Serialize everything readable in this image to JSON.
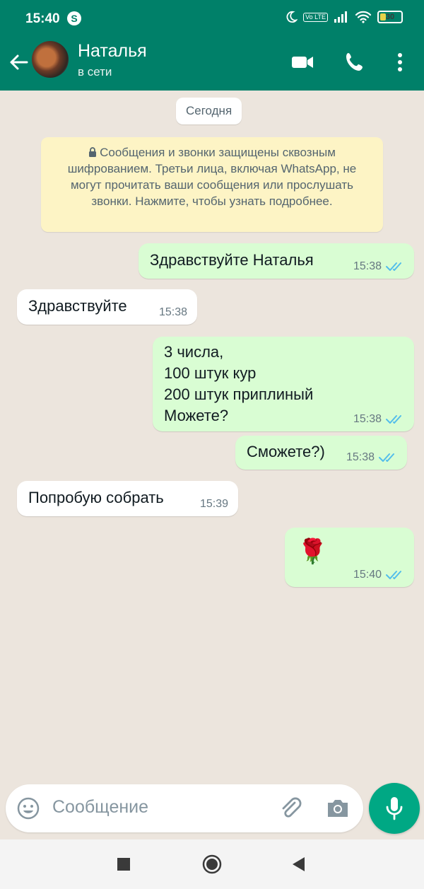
{
  "status_bar": {
    "time": "15:40",
    "app_badge": "S",
    "volte": "Vo LTE",
    "battery": "30",
    "battery_level": 0.3
  },
  "header": {
    "contact_name": "Наталья",
    "contact_status": "в сети"
  },
  "chat": {
    "date_chip": "Сегодня",
    "encryption_notice": "Сообщения и звонки защищены сквозным шифрованием. Третьи лица, включая WhatsApp, не могут прочитать ваши сообщения или прослушать звонки. Нажмите, чтобы узнать подробнее.",
    "messages": [
      {
        "direction": "out",
        "text": "Здравствуйте Наталья",
        "time": "15:38",
        "status": "read"
      },
      {
        "direction": "in",
        "text": "Здравствуйте",
        "time": "15:38"
      },
      {
        "direction": "out",
        "text": "3 числа,\n100 штук кур\n200 штук приплиный\nМожете?",
        "time": "15:38",
        "status": "read"
      },
      {
        "direction": "out",
        "text": "Сможете?)",
        "time": "15:38",
        "status": "read"
      },
      {
        "direction": "in",
        "text": "Попробую собрать",
        "time": "15:39"
      },
      {
        "direction": "out",
        "text": "🌹",
        "time": "15:40",
        "status": "read"
      }
    ]
  },
  "composer": {
    "placeholder": "Сообщение"
  },
  "colors": {
    "header": "#008069",
    "outgoing_bubble": "#d9fdd3",
    "incoming_bubble": "#ffffff",
    "read_ticks": "#53bdeb",
    "mic_button": "#00a884"
  },
  "icons": [
    "back-arrow-icon",
    "video-call-icon",
    "phone-icon",
    "more-vert-icon",
    "lock-icon",
    "double-check-icon",
    "emoji-icon",
    "attach-icon",
    "camera-icon",
    "mic-icon",
    "nav-recents-icon",
    "nav-home-icon",
    "nav-back-icon"
  ]
}
